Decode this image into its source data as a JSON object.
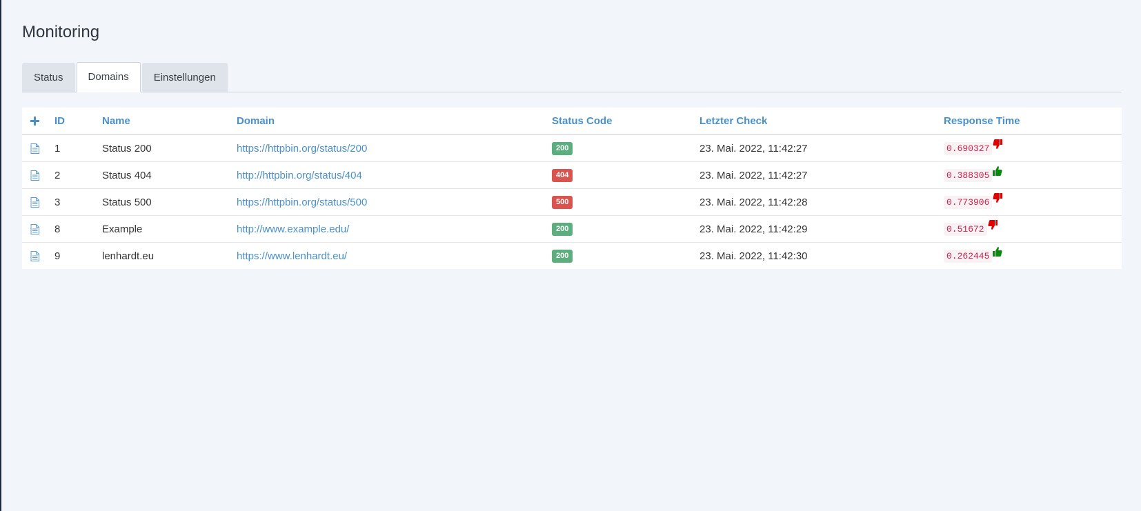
{
  "page": {
    "title": "Monitoring"
  },
  "tabs": [
    {
      "label": "Status",
      "active": false
    },
    {
      "label": "Domains",
      "active": true
    },
    {
      "label": "Einstellungen",
      "active": false
    }
  ],
  "table": {
    "headers": {
      "add_icon": "plus-icon",
      "id": "ID",
      "name": "Name",
      "domain": "Domain",
      "status_code": "Status Code",
      "last_check": "Letzter Check",
      "response_time": "Response Time"
    },
    "rows": [
      {
        "id": "1",
        "name": "Status 200",
        "domain": "https://httpbin.org/status/200",
        "status_code": "200",
        "status_color": "#5cae7f",
        "last_check": "23. Mai. 2022, 11:42:27",
        "response_time": "0.690327",
        "rating": "thumbs-down-icon"
      },
      {
        "id": "2",
        "name": "Status 404",
        "domain": "http://httpbin.org/status/404",
        "status_code": "404",
        "status_color": "#d9534f",
        "last_check": "23. Mai. 2022, 11:42:27",
        "response_time": "0.388305",
        "rating": "thumbs-up-icon"
      },
      {
        "id": "3",
        "name": "Status 500",
        "domain": "https://httpbin.org/status/500",
        "status_code": "500",
        "status_color": "#d9534f",
        "last_check": "23. Mai. 2022, 11:42:28",
        "response_time": "0.773906",
        "rating": "thumbs-down-icon"
      },
      {
        "id": "8",
        "name": "Example",
        "domain": "http://www.example.edu/",
        "status_code": "200",
        "status_color": "#5cae7f",
        "last_check": "23. Mai. 2022, 11:42:29",
        "response_time": "0.51672",
        "rating": "thumbs-down-icon"
      },
      {
        "id": "9",
        "name": "lenhardt.eu",
        "domain": "https://www.lenhardt.eu/",
        "status_code": "200",
        "status_color": "#5cae7f",
        "last_check": "23. Mai. 2022, 11:42:30",
        "response_time": "0.262445",
        "rating": "thumbs-up-icon"
      }
    ]
  },
  "colors": {
    "accent": "#4a90c8",
    "success": "#5cae7f",
    "danger": "#d9534f",
    "thumb_up": "#0a8a0a",
    "thumb_down": "#e00000"
  }
}
